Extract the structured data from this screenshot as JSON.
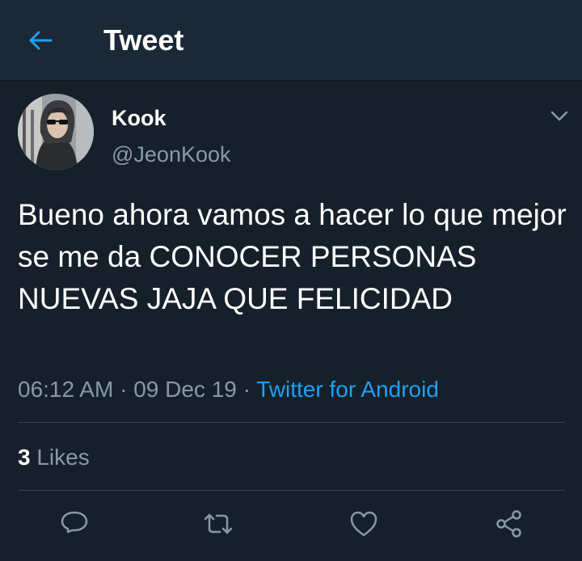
{
  "header": {
    "title": "Tweet",
    "back_icon": "arrow-left-icon"
  },
  "tweet": {
    "author": {
      "name": "Kook",
      "handle": "@JeonKook"
    },
    "text": "Bueno ahora vamos a hacer lo que mejor se me da CONOCER PERSONAS NUEVAS JAJA QUE FELICIDAD",
    "time": "06:12 AM",
    "date": "09 Dec 19",
    "separator": " · ",
    "source": "Twitter for Android",
    "likes_count": "3",
    "likes_label": " Likes",
    "caret_icon": "chevron-down-icon"
  },
  "actions": [
    {
      "name": "reply-icon"
    },
    {
      "name": "retweet-icon"
    },
    {
      "name": "like-icon"
    },
    {
      "name": "share-icon"
    }
  ],
  "colors": {
    "background": "#15202b",
    "header": "#1b2836",
    "accent": "#1da1f2",
    "secondary_text": "#8899a6",
    "divider": "#38444d"
  }
}
